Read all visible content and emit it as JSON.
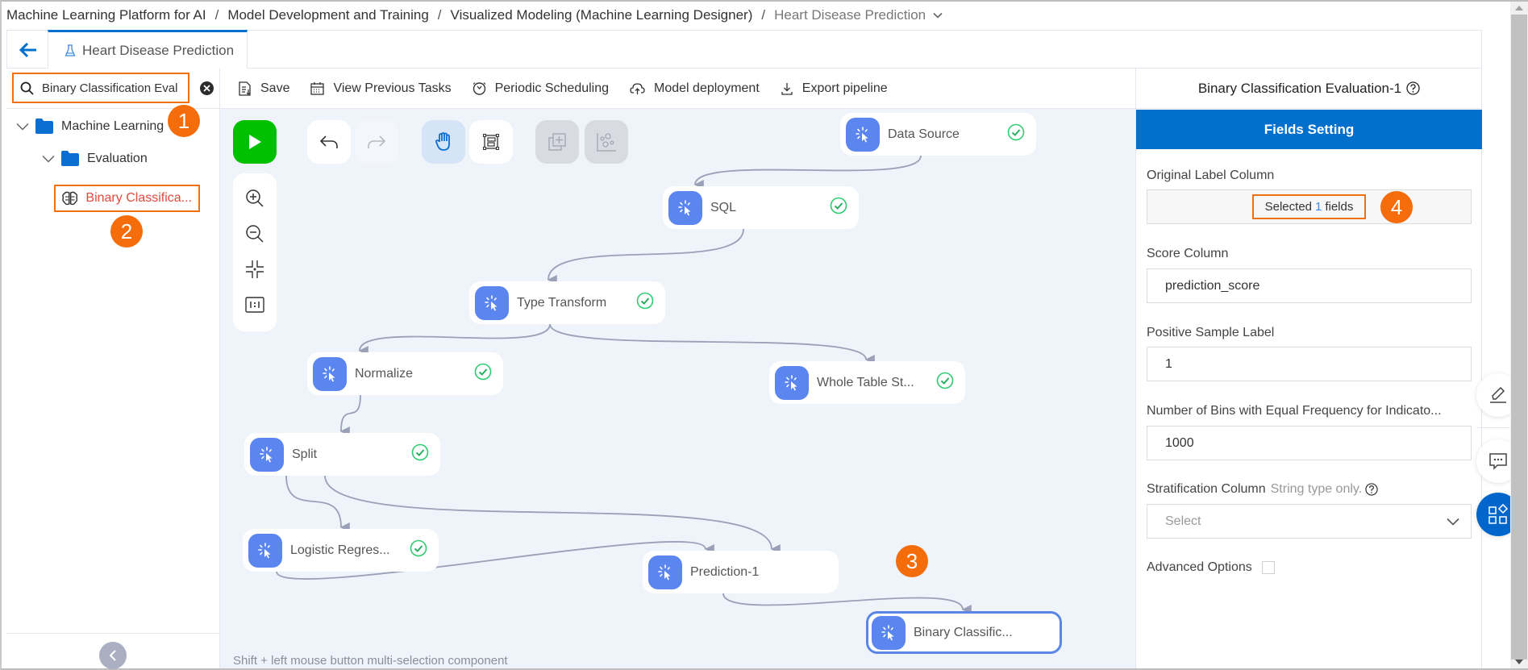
{
  "breadcrumb": {
    "items": [
      "Machine Learning Platform for AI",
      "Model Development and Training",
      "Visualized Modeling (Machine Learning Designer)"
    ],
    "separator": "/",
    "current": "Heart Disease Prediction"
  },
  "tabbar": {
    "active_tab": "Heart Disease Prediction"
  },
  "sidebar": {
    "search": {
      "value": "Binary Classification Eval",
      "placeholder": ""
    },
    "tree": [
      {
        "label": "Machine Learning",
        "type": "folder",
        "expanded": true
      },
      {
        "label": "Evaluation",
        "type": "folder",
        "expanded": true
      },
      {
        "label": "Binary Classifica...",
        "type": "component",
        "highlighted": true
      }
    ]
  },
  "annotations": {
    "badge1": "1",
    "badge2": "2",
    "badge3": "3",
    "badge4": "4"
  },
  "toolbar": {
    "save": "Save",
    "view_previous_tasks": "View Previous Tasks",
    "periodic_scheduling": "Periodic Scheduling",
    "model_deployment": "Model deployment",
    "export_pipeline": "Export pipeline"
  },
  "canvas": {
    "hint": "Shift + left mouse button multi-selection component",
    "nodes": [
      {
        "id": "data-source",
        "label": "Data Source",
        "status": "success"
      },
      {
        "id": "sql",
        "label": "SQL",
        "status": "success"
      },
      {
        "id": "type-transform",
        "label": "Type Transform",
        "status": "success"
      },
      {
        "id": "normalize",
        "label": "Normalize",
        "status": "success"
      },
      {
        "id": "whole-table",
        "label": "Whole Table St...",
        "status": "success"
      },
      {
        "id": "split",
        "label": "Split",
        "status": "success"
      },
      {
        "id": "logistic",
        "label": "Logistic Regres...",
        "status": "success"
      },
      {
        "id": "prediction",
        "label": "Prediction-1",
        "status": "none"
      },
      {
        "id": "binary",
        "label": "Binary Classific...",
        "status": "none",
        "selected": true
      }
    ],
    "edges": [
      [
        "data-source",
        "sql"
      ],
      [
        "sql",
        "type-transform"
      ],
      [
        "type-transform",
        "normalize"
      ],
      [
        "type-transform",
        "whole-table"
      ],
      [
        "normalize",
        "split"
      ],
      [
        "split",
        "logistic"
      ],
      [
        "split",
        "prediction"
      ],
      [
        "logistic",
        "prediction"
      ],
      [
        "prediction",
        "binary"
      ]
    ]
  },
  "panel": {
    "title": "Binary Classification Evaluation-1",
    "tab": "Fields Setting",
    "original_label_column": {
      "label": "Original Label Column",
      "prefix": "Selected",
      "count": "1",
      "suffix": "fields"
    },
    "score_column": {
      "label": "Score Column",
      "value": "prediction_score"
    },
    "positive_sample_label": {
      "label": "Positive Sample Label",
      "value": "1"
    },
    "num_bins": {
      "label": "Number of Bins with Equal Frequency for Indicato...",
      "value": "1000"
    },
    "stratification_column": {
      "label": "Stratification Column",
      "hint": "String type only.",
      "placeholder": "Select"
    },
    "advanced_options": {
      "label": "Advanced Options",
      "checked": false
    }
  },
  "colors": {
    "accent": "#0070cc",
    "annotation": "#f56c0a",
    "run": "#00c000",
    "node_icon": "#5b86f0",
    "success": "#2ecc71",
    "leaf_text": "#e04a3f"
  }
}
